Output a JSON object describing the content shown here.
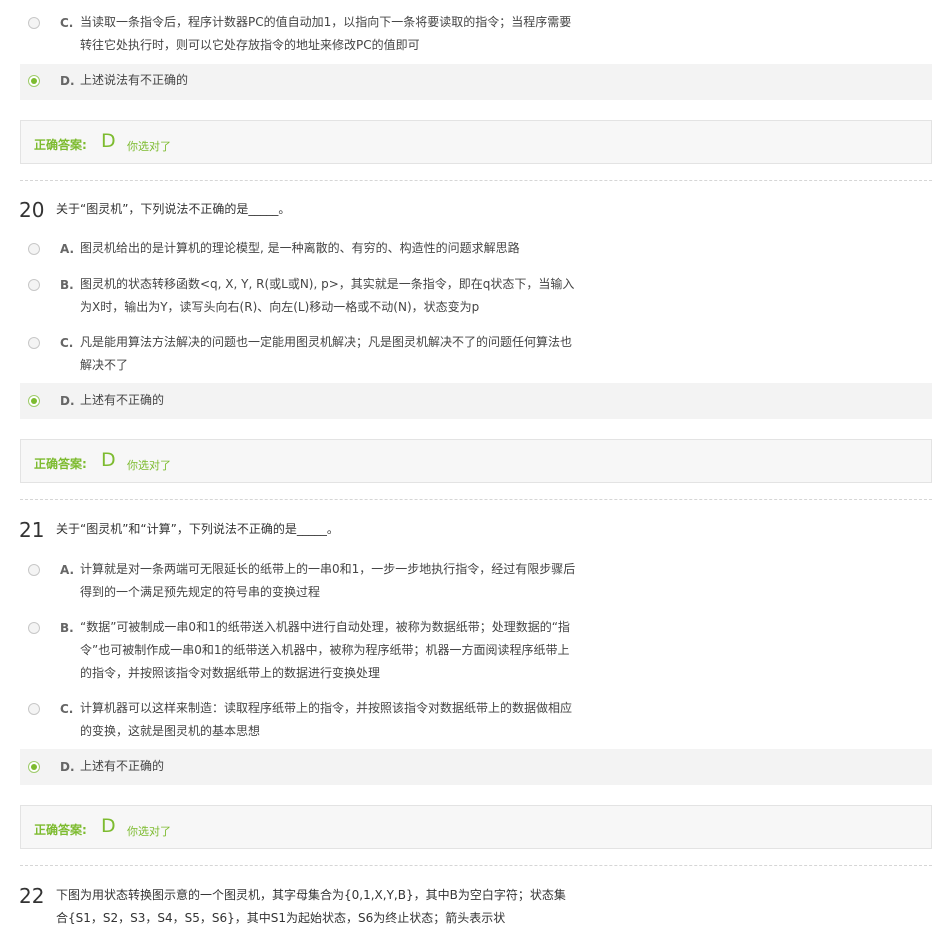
{
  "q19": {
    "options": [
      {
        "letter": "C.",
        "text": "当读取一条指令后，程序计数器PC的值自动加1，以指向下一条将要读取的指令；当程序需要转往它处执行时，则可以它处存放指令的地址来修改PC的值即可"
      },
      {
        "letter": "D.",
        "text": "上述说法有不正确的"
      }
    ],
    "answer": {
      "label": "正确答案:",
      "letter": "D",
      "note": "你选对了"
    }
  },
  "q20": {
    "number": "20",
    "text": "关于“图灵机”，下列说法不正确的是_____。",
    "options": [
      {
        "letter": "A.",
        "text": "图灵机给出的是计算机的理论模型, 是一种离散的、有穷的、构造性的问题求解思路"
      },
      {
        "letter": "B.",
        "text": "图灵机的状态转移函数<q, X, Y, R(或L或N), p>，其实就是一条指令，即在q状态下，当输入为X时，输出为Y，读写头向右(R)、向左(L)移动一格或不动(N)，状态变为p"
      },
      {
        "letter": "C.",
        "text": "凡是能用算法方法解决的问题也一定能用图灵机解决；凡是图灵机解决不了的问题任何算法也解决不了"
      },
      {
        "letter": "D.",
        "text": "上述有不正确的"
      }
    ],
    "answer": {
      "label": "正确答案:",
      "letter": "D",
      "note": "你选对了"
    }
  },
  "q21": {
    "number": "21",
    "text": "关于“图灵机”和“计算”，下列说法不正确的是_____。",
    "options": [
      {
        "letter": "A.",
        "text": "计算就是对一条两端可无限延长的纸带上的一串0和1，一步一步地执行指令，经过有限步骤后得到的一个满足预先规定的符号串的变换过程"
      },
      {
        "letter": "B.",
        "text": "“数据”可被制成一串0和1的纸带送入机器中进行自动处理，被称为数据纸带；处理数据的“指令”也可被制作成一串0和1的纸带送入机器中，被称为程序纸带；机器一方面阅读程序纸带上的指令，并按照该指令对数据纸带上的数据进行变换处理"
      },
      {
        "letter": "C.",
        "text": "计算机器可以这样来制造：读取程序纸带上的指令，并按照该指令对数据纸带上的数据做相应的变换，这就是图灵机的基本思想"
      },
      {
        "letter": "D.",
        "text": "上述有不正确的"
      }
    ],
    "answer": {
      "label": "正确答案:",
      "letter": "D",
      "note": "你选对了"
    }
  },
  "q22": {
    "number": "22",
    "text": "下图为用状态转换图示意的一个图灵机，其字母集合为{0,1,X,Y,B}，其中B为空白字符；状态集合{S1，S2，S3，S4，S5，S6}，其中S1为起始状态，S6为终止状态；箭头表示状"
  }
}
